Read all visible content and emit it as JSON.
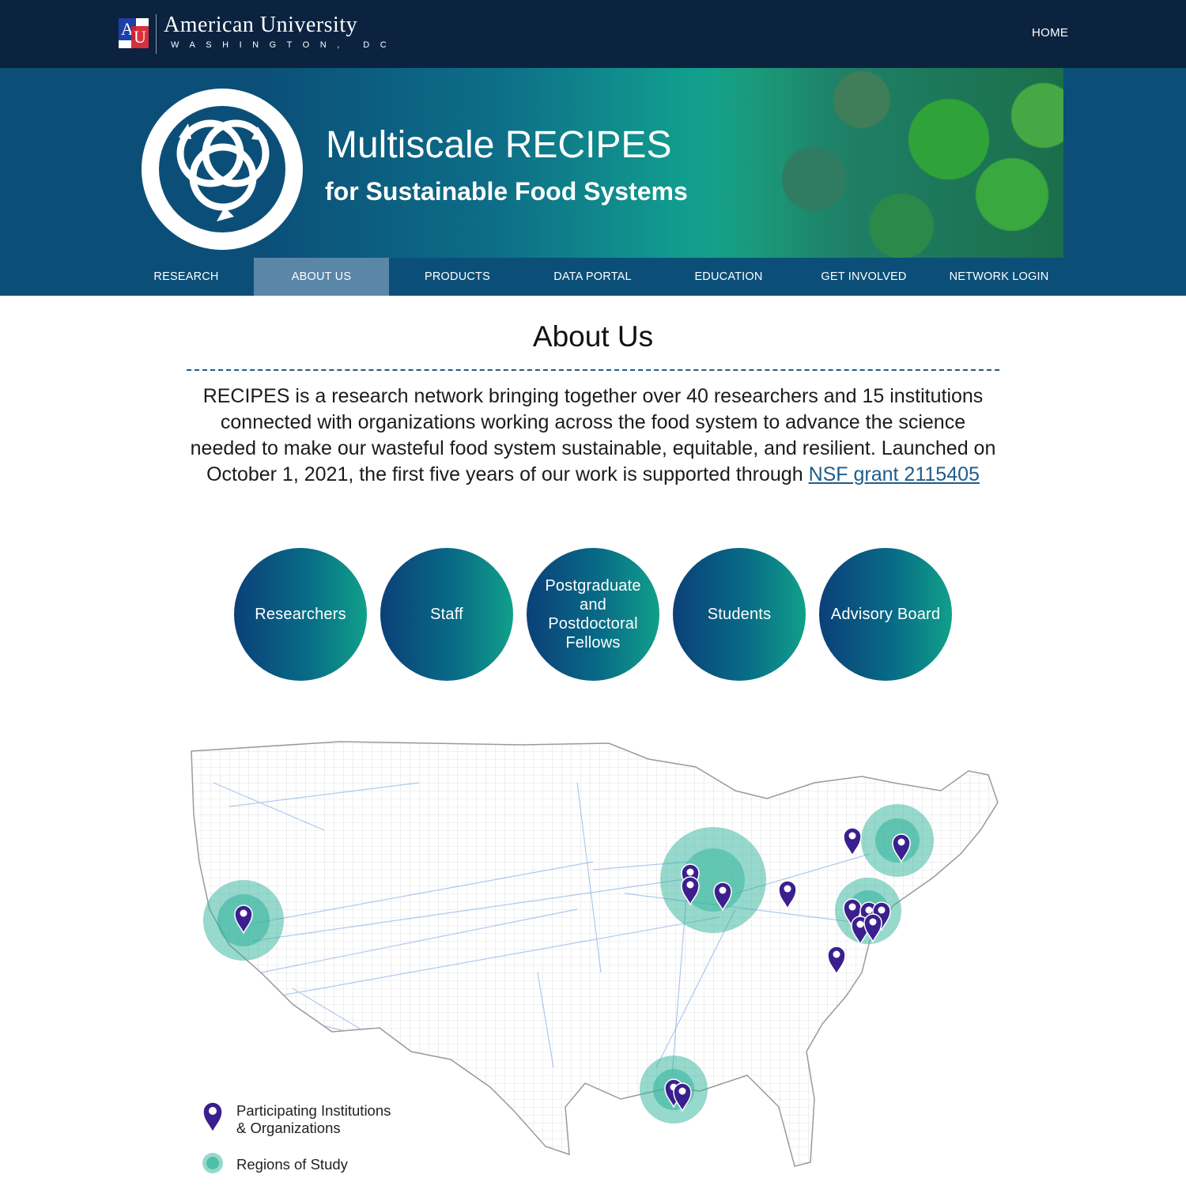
{
  "header": {
    "university_name": "American University",
    "university_city": "WASHINGTON, DC",
    "home_link": "HOME"
  },
  "banner": {
    "title": "Multiscale RECIPES",
    "subtitle": "for Sustainable Food Systems"
  },
  "nav": {
    "items": [
      {
        "label": "RESEARCH",
        "active": false
      },
      {
        "label": "ABOUT US",
        "active": true
      },
      {
        "label": "PRODUCTS",
        "active": false
      },
      {
        "label": "DATA PORTAL",
        "active": false
      },
      {
        "label": "EDUCATION",
        "active": false
      },
      {
        "label": "GET INVOLVED",
        "active": false
      },
      {
        "label": "NETWORK LOGIN",
        "active": false
      }
    ]
  },
  "main": {
    "title": "About Us",
    "intro_text": "RECIPES is a research network bringing together over 40 researchers and 15 institutions connected with organizations working across the food system to advance the science needed to make our wasteful food system sustainable, equitable, and resilient. Launched on October 1, 2021, the first five years of our work is supported through ",
    "intro_link": "NSF grant 2115405",
    "groups": [
      "Researchers",
      "Staff",
      "Postgraduate and Postdoctoral Fellows",
      "Students",
      "Advisory Board"
    ]
  },
  "legend": {
    "institutions_line1": "Participating Institutions",
    "institutions_line2": "& Organizations",
    "regions": "Regions of Study"
  },
  "colors": {
    "header_bg": "#0c2340",
    "nav_bg": "#0b4f78",
    "nav_active": "#5a86a8",
    "pin": "#3b1f8e",
    "region": "#2fb39a",
    "link": "#1f5c8a"
  }
}
